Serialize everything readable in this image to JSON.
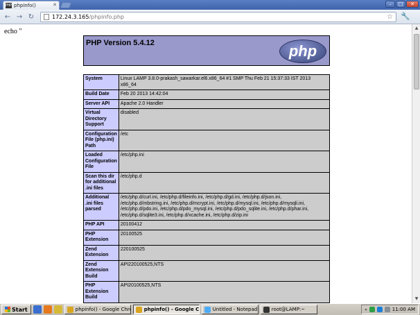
{
  "browser": {
    "tab_title": "phpinfo()",
    "tab_favicon": "PHP",
    "url_host": "172.24.3.165",
    "url_path": "/phpinfo.php"
  },
  "page": {
    "echo_text": "echo \"",
    "php_version": "PHP Version 5.4.12",
    "php_logo": "php",
    "rows": [
      {
        "key": "System",
        "value": "Linux LAMP 3.8.0-prakash_sawarkar.el6.x86_64 #1 SMP Thu Feb 21 15:37:33 IST 2013 x86_64"
      },
      {
        "key": "Build Date",
        "value": "Feb 20 2013 14:42:04"
      },
      {
        "key": "Server API",
        "value": "Apache 2.0 Handler"
      },
      {
        "key": "Virtual Directory Support",
        "value": "disabled"
      },
      {
        "key": "Configuration File (php.ini) Path",
        "value": "/etc"
      },
      {
        "key": "Loaded Configuration File",
        "value": "/etc/php.ini"
      },
      {
        "key": "Scan this dir for additional .ini files",
        "value": "/etc/php.d"
      },
      {
        "key": "Additional .ini files parsed",
        "value": "/etc/php.d/curl.ini, /etc/php.d/fileinfo.ini, /etc/php.d/gd.ini, /etc/php.d/json.ini, /etc/php.d/mbstring.ini, /etc/php.d/mcrypt.ini, /etc/php.d/mysql.ini, /etc/php.d/mysqli.ini, /etc/php.d/pdo.ini, /etc/php.d/pdo_mysql.ini, /etc/php.d/pdo_sqlite.ini, /etc/php.d/phar.ini, /etc/php.d/sqlite3.ini, /etc/php.d/xcache.ini, /etc/php.d/zip.ini"
      },
      {
        "key": "PHP API",
        "value": "20100412"
      },
      {
        "key": "PHP Extension",
        "value": "20100525"
      },
      {
        "key": "Zend Extension",
        "value": "220100525"
      },
      {
        "key": "Zend Extension Build",
        "value": "API220100525,NTS"
      },
      {
        "key": "PHP Extension Build",
        "value": "API20100525,NTS"
      }
    ]
  },
  "taskbar": {
    "start_label": "Start",
    "tasks": [
      {
        "label": "phpinfo() - Google Chrome",
        "active": false
      },
      {
        "label": "phpinfo() - Google Ch...",
        "active": true
      },
      {
        "label": "Untitled - Notepad",
        "active": false
      },
      {
        "label": "root@LAMP:~",
        "active": false
      }
    ],
    "clock": "11:00 AM"
  },
  "colors": {
    "php_header": "#9999cc",
    "key_cell": "#ccccff",
    "value_cell": "#cccccc"
  }
}
